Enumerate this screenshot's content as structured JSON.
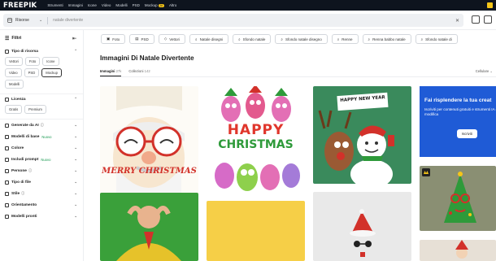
{
  "topbar": {
    "logo": "FREEPIK",
    "nav": [
      "Strumenti",
      "Immagini",
      "Icone",
      "Video",
      "Modelli",
      "PSD",
      "Mockup",
      "AI",
      "Altro"
    ],
    "ai_badge": "AI"
  },
  "search": {
    "type_label": "Risorse",
    "query": "natale divertente"
  },
  "sidebar": {
    "title": "Filtri",
    "sections": [
      {
        "label": "Tipo di risorsa",
        "chips": [
          "Vettori",
          "Foto",
          "Icone",
          "Video",
          "PSD",
          "Mockup",
          "Modelli"
        ],
        "selected": "Foto"
      },
      {
        "label": "Licenza",
        "chips": [
          "Gratis",
          "Premium"
        ]
      },
      {
        "label": "Generate da AI"
      },
      {
        "label": "Modelli di base",
        "badge": "Nuovo"
      },
      {
        "label": "Colore"
      },
      {
        "label": "Includi prompt",
        "badge": "Nuovo"
      },
      {
        "label": "Persone"
      },
      {
        "label": "Tipo di file"
      },
      {
        "label": "Stile"
      },
      {
        "label": "Orientamento"
      },
      {
        "label": "Modelli pronti"
      }
    ]
  },
  "filters": [
    "Foto",
    "PSD",
    "Vettori",
    "Natale disegni",
    "Sfondo natale",
    "Sfondo natale disegno",
    "Renne",
    "Renna babbo natale",
    "Sfondo natale di"
  ],
  "main": {
    "title": "Immagini Di Natale Divertente",
    "tabs": [
      {
        "label": "Immagini",
        "count": "27k"
      },
      {
        "label": "Collezioni",
        "count": "142"
      }
    ],
    "sort": "Cellulare"
  },
  "cards": [
    {
      "name": "santa-glasses-card",
      "caption": "MERRY CHRISTMAS"
    },
    {
      "name": "monsters-card",
      "lines": [
        "HAPPY",
        "CHRISTMAS"
      ]
    },
    {
      "name": "new-year-card",
      "caption": "HAPPY NEW YEAR"
    },
    {
      "name": "promo-card",
      "title": "Fai risplendere la tua creat",
      "text": "Iscriviti per contenuti gratuiti e strumenti IA e di modifica",
      "button": "Iscriviti"
    }
  ],
  "colors": {
    "accent": "#1f5bd6",
    "topbar": "#0e141e"
  }
}
